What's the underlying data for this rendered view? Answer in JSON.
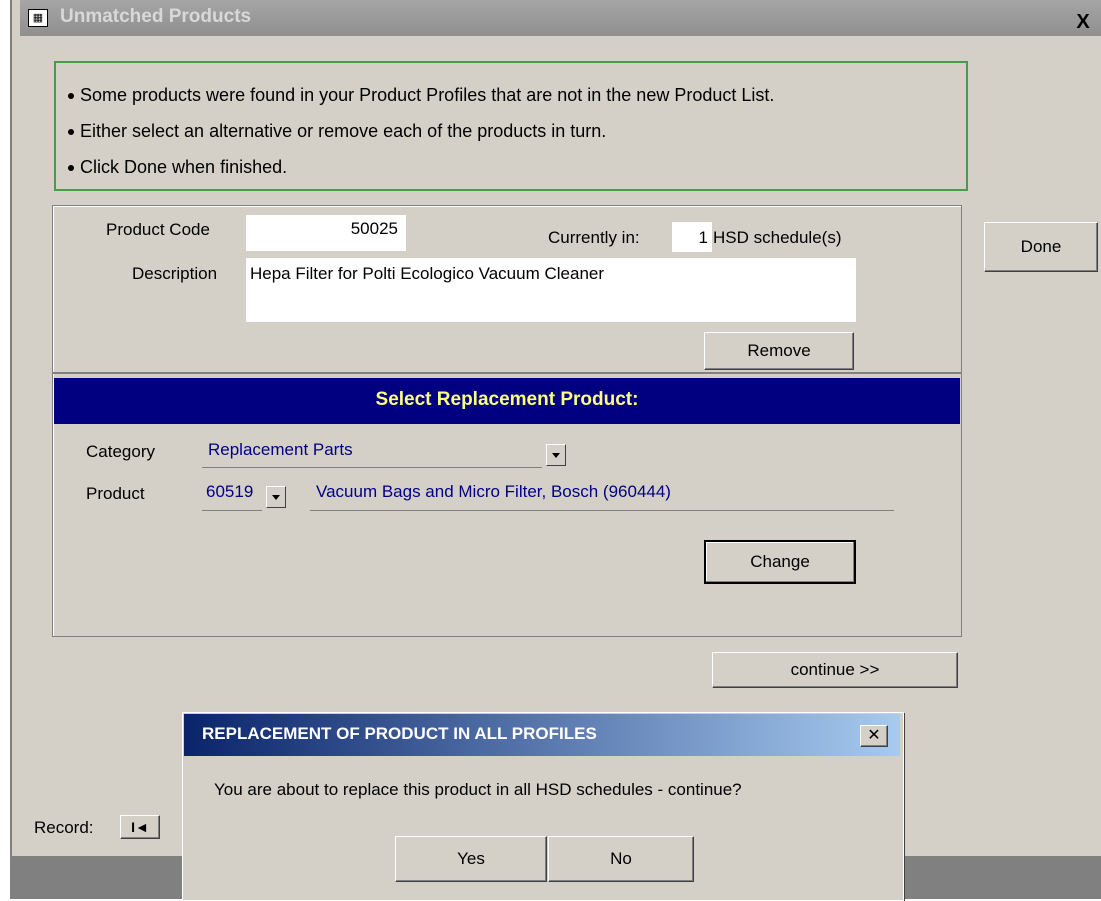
{
  "window": {
    "title": "Unmatched Products",
    "close_glyph": "X"
  },
  "instructions": [
    "Some products were found in your Product Profiles that are not in the new Product List.",
    "Either select an alternative or remove each of the products in turn.",
    "Click Done when finished."
  ],
  "product": {
    "code_label": "Product Code",
    "code_value": "50025",
    "currently_in_label": "Currently in:",
    "currently_in_value": "1",
    "schedule_suffix": "HSD schedule(s)",
    "description_label": "Description",
    "description_value": "Hepa Filter for Polti Ecologico Vacuum Cleaner",
    "remove_label": "Remove"
  },
  "done_label": "Done",
  "replacement": {
    "header": "Select Replacement Product:",
    "category_label": "Category",
    "category_value": "Replacement Parts",
    "product_label": "Product",
    "product_code": "60519",
    "product_desc": "Vacuum Bags and Micro Filter, Bosch (960444)",
    "change_label": "Change"
  },
  "continue_label": "continue >>",
  "record_nav": {
    "label": "Record:",
    "first_glyph": "I◄"
  },
  "dialog": {
    "title": "REPLACEMENT OF PRODUCT IN ALL PROFILES",
    "close_glyph": "✕",
    "message": "You are about to replace this product in all HSD schedules - continue?",
    "yes_label": "Yes",
    "no_label": "No"
  },
  "colors": {
    "face": "#d4d0c8",
    "header_bg": "#000080",
    "header_text": "#ffff80",
    "link_text": "#000080",
    "instruction_border": "#4a9a4a"
  },
  "icons": {
    "title_icon": "form-icon",
    "combo_arrow": "chevron-down-icon"
  }
}
